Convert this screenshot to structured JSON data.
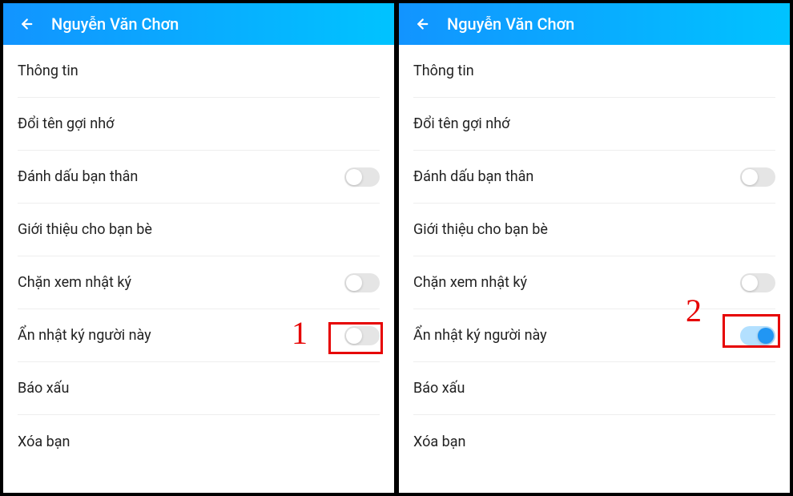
{
  "panes": [
    {
      "header_title": "Nguyễn Văn Chơn",
      "rows": [
        {
          "label": "Thông tin",
          "toggle": null
        },
        {
          "label": "Đổi tên gợi nhớ",
          "toggle": null
        },
        {
          "label": "Đánh dấu bạn thân",
          "toggle": false
        },
        {
          "label": "Giới thiệu cho bạn bè",
          "toggle": null
        },
        {
          "label": "Chặn xem nhật ký",
          "toggle": false
        },
        {
          "label": "Ẩn nhật ký người này",
          "toggle": false,
          "highlight": true
        },
        {
          "label": "Báo xấu",
          "toggle": null
        },
        {
          "label": "Xóa bạn",
          "toggle": null
        }
      ],
      "annotation": "1"
    },
    {
      "header_title": "Nguyễn Văn Chơn",
      "rows": [
        {
          "label": "Thông tin",
          "toggle": null
        },
        {
          "label": "Đổi tên gợi nhớ",
          "toggle": null
        },
        {
          "label": "Đánh dấu bạn thân",
          "toggle": false
        },
        {
          "label": "Giới thiệu cho bạn bè",
          "toggle": null
        },
        {
          "label": "Chặn xem nhật ký",
          "toggle": false
        },
        {
          "label": "Ẩn nhật ký người này",
          "toggle": true,
          "highlight": true
        },
        {
          "label": "Báo xấu",
          "toggle": null
        },
        {
          "label": "Xóa bạn",
          "toggle": null
        }
      ],
      "annotation": "2"
    }
  ]
}
